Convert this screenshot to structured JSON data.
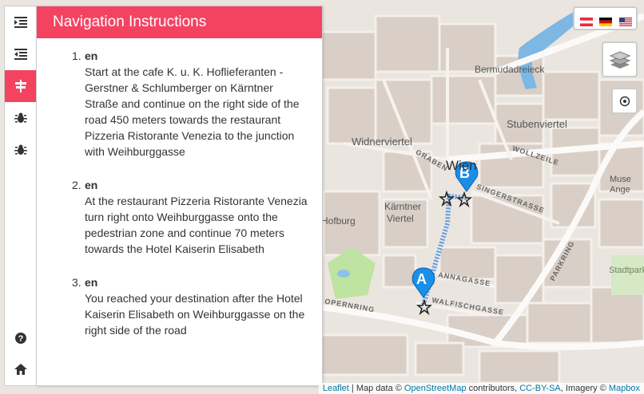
{
  "panel": {
    "title": "Navigation Instructions",
    "steps": [
      {
        "num": "1.",
        "lang": "en",
        "text": "Start at the cafe K. u. K. Hoflieferanten - Gerstner & Schlumberger on Kärntner Straße and continue on the right side of the road 450 meters towards the restaurant Pizzeria Ristorante Venezia to the junction with Weihburggasse"
      },
      {
        "num": "2.",
        "lang": "en",
        "text": "At the restaurant Pizzeria Ristorante Venezia turn right onto Weihburggasse onto the pedestrian zone and continue 70 meters towards the Hotel Kaiserin Elisabeth"
      },
      {
        "num": "3.",
        "lang": "en",
        "text": "You reached your destination after the Hotel Kaiserin Elisabeth on Weihburggasse on the right side of the road"
      }
    ]
  },
  "sidebar": {
    "icons": [
      "list-indent-icon",
      "list-outdent-icon",
      "signpost-icon",
      "bug-icon",
      "bug-icon",
      "help-icon",
      "home-icon"
    ],
    "active_index": 2
  },
  "map": {
    "labels": {
      "bermudadreieck": "Bermudadreieck",
      "stubenviertel": "Stubenviertel",
      "wien": "Wien",
      "karntner_viertel_1": "Kärntner",
      "karntner_viertel_2": "Viertel",
      "hofburg": "Hofburg",
      "wildnerviertel": "Widnerviertel",
      "museum_1": "Muse",
      "museum_2": "Ange",
      "stadtpark": "Stadtpark"
    },
    "streets": {
      "graben": "GRABEN",
      "wollzeile": "WOLLZEILE",
      "singerstrasse": "SINGERSTRASSE",
      "annagasse": "ANNAGASSE",
      "walfischgasse": "WALFISCHGASSE",
      "opernring": "OPERNRING",
      "parkring": "PARKRING"
    },
    "markers": {
      "start": "A",
      "end": "B"
    },
    "route_color": "#4a8fe0",
    "marker_color": "#1a8fe8"
  },
  "controls": {
    "languages": [
      "at-flag",
      "de-flag",
      "us-flag"
    ],
    "layers_icon": "layers-icon",
    "locate_icon": "locate-icon"
  },
  "attribution": {
    "leaflet": "Leaflet",
    "sep1": " | Map data © ",
    "osm": "OpenStreetMap",
    "contrib": " contributors, ",
    "license": "CC-BY-SA",
    "imagery": ", Imagery © ",
    "mapbox": "Mapbox"
  }
}
